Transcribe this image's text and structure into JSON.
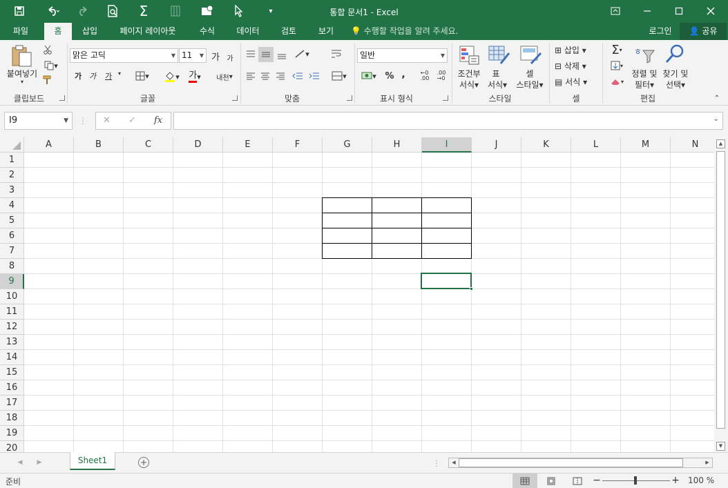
{
  "window": {
    "title": "통합 문서1 - Excel",
    "accent_color": "#217346"
  },
  "quick_access": {
    "save_icon": "save-icon",
    "undo_icon": "undo-icon",
    "redo_icon": "redo-icon",
    "print_preview_icon": "print-preview-icon",
    "autosum_icon": "sigma-icon"
  },
  "tabs": [
    {
      "label": "파일",
      "active": false
    },
    {
      "label": "홈",
      "active": true
    },
    {
      "label": "삽입",
      "active": false
    },
    {
      "label": "페이지 레이아웃",
      "active": false
    },
    {
      "label": "수식",
      "active": false
    },
    {
      "label": "데이터",
      "active": false
    },
    {
      "label": "검토",
      "active": false
    },
    {
      "label": "보기",
      "active": false
    }
  ],
  "tell_me": "수행할 작업을 알려 주세요.",
  "login": "로그인",
  "share": "공유",
  "ribbon": {
    "clipboard": {
      "paste": "붙여넣기",
      "label": "클립보드"
    },
    "font": {
      "name": "맑은 고딕",
      "size": "11",
      "grow": "가",
      "shrink": "가",
      "bold": "가",
      "italic": "가",
      "underline": "가",
      "font_color": "가",
      "phonetic": "내천",
      "label": "글꼴"
    },
    "alignment": {
      "label": "맞춤"
    },
    "number": {
      "format": "일반",
      "percent": "%",
      "comma": ",",
      "inc": "←0\n.00",
      "dec": ".00\n→0",
      "label": "표시 형식"
    },
    "styles": {
      "cond_1": "조건부",
      "cond_2": "서식",
      "table_1": "표",
      "table_2": "서식",
      "cell_1": "셀",
      "cell_2": "스타일",
      "label": "스타일"
    },
    "cells": {
      "insert": "삽입",
      "delete": "삭제",
      "format": "서식",
      "label": "셀"
    },
    "editing": {
      "sort_1": "정렬 및",
      "sort_2": "필터",
      "find_1": "찾기 및",
      "find_2": "선택",
      "label": "편집"
    }
  },
  "formula_bar": {
    "name_box": "I9",
    "cancel": "✕",
    "enter": "✓",
    "fx": "fx",
    "value": ""
  },
  "grid": {
    "columns": [
      "A",
      "B",
      "C",
      "D",
      "E",
      "F",
      "G",
      "H",
      "I",
      "J",
      "K",
      "L",
      "M",
      "N"
    ],
    "rows": [
      "1",
      "2",
      "3",
      "4",
      "5",
      "6",
      "7",
      "8",
      "9",
      "10",
      "11",
      "12",
      "13",
      "14",
      "15",
      "16",
      "17",
      "18",
      "19",
      "20"
    ],
    "active_cell": "I9",
    "bordered_range": "G4:I7"
  },
  "sheets": [
    {
      "name": "Sheet1",
      "active": true
    }
  ],
  "status": {
    "text": "준비",
    "zoom": "100 %"
  }
}
